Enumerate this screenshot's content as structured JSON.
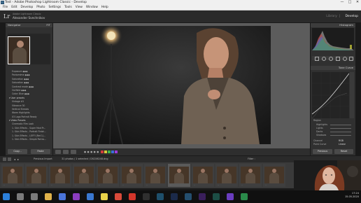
{
  "window": {
    "title": "Test - Adobe Photoshop Lightroom Classic - Develop",
    "controls": [
      "—",
      "□",
      "✕"
    ]
  },
  "menu": [
    "File",
    "Edit",
    "Develop",
    "Photo",
    "Settings",
    "Tools",
    "View",
    "Window",
    "Help"
  ],
  "identity": {
    "logo": "Lr",
    "line1": "Adobe Lightroom Classic",
    "line2": "Alexander Svechnikov",
    "modules": [
      "Library",
      "Develop"
    ],
    "active_module": "Develop"
  },
  "left_panel": {
    "navigator_label": "Navigator",
    "navigator_zoom": "FIT",
    "presets": [
      "Exposure ◆◆◆",
      "Pantomime ◆◆◆",
      "Saturation ◆◆◆",
      "Saturation ◆◆◆",
      "Contrast mode ◆◆◆",
      "Outfield ◆◆◆",
      "Color: Blue ◆◆◆"
    ],
    "group2_label": "▾ User presets",
    "group2": [
      "Vintage #1",
      "Vibrance 30",
      "Vertical Streaks",
      "Warm Highlights",
      "X3 Logo Portrait Ready"
    ],
    "group3_label": "▾ Video Presets",
    "group3": [
      "Cinematic Film Look",
      "1. Skin Effects - Super Mod Pr...",
      "1. Skin Effects - Portrait Finish...",
      "1. Skin Effects - LOFFI (Ret 1)...",
      "1. Skin Effects - Simple Portra..."
    ],
    "copy_label": "Copy...",
    "paste_label": "Paste"
  },
  "right_panel": {
    "histogram_label": "Histogram",
    "tone_curve_label": "Tone Curve",
    "region_label": "Region",
    "sliders": [
      "Highlights",
      "Lights",
      "Darks",
      "Shadows"
    ],
    "channel_label": "Channel",
    "channel_value": "RGB",
    "point_curve_label": "Point Curve",
    "point_curve_value": "Linear",
    "previous_label": "Previous",
    "reset_label": "Reset"
  },
  "filmstrip": {
    "source": "Previous Import",
    "info": "31 photos / 1 selected / DSC06248.dng",
    "filter_label": "Filter :"
  },
  "taskbar": {
    "icons": [
      {
        "name": "start-icon",
        "color": "#2b7fd9"
      },
      {
        "name": "search-icon",
        "color": "#7a7a7a"
      },
      {
        "name": "task-view-icon",
        "color": "#7a7a7a"
      },
      {
        "name": "explorer-icon",
        "color": "#e0b24a"
      },
      {
        "name": "store-icon",
        "color": "#4a74d9"
      },
      {
        "name": "onenote-icon",
        "color": "#8b3dbf"
      },
      {
        "name": "mail-icon",
        "color": "#3a78d0"
      },
      {
        "name": "yandex-icon",
        "color": "#e8d24a"
      },
      {
        "name": "browser-icon",
        "color": "#d94a3a"
      },
      {
        "name": "opera-icon",
        "color": "#d3362b"
      },
      {
        "name": "media-icon",
        "color": "#2f2f2f"
      },
      {
        "name": "lightroom-icon",
        "color": "#1e4f6b"
      },
      {
        "name": "photoshop-icon",
        "color": "#1b2a4a"
      },
      {
        "name": "lightroom-classic-icon",
        "color": "#244e6e"
      },
      {
        "name": "premiere-icon",
        "color": "#3a1f5c"
      },
      {
        "name": "audition-icon",
        "color": "#1c4d45"
      },
      {
        "name": "app-icon",
        "color": "#6a3dbf"
      },
      {
        "name": "vpn-icon",
        "color": "#2a8a4a"
      }
    ],
    "time": "17:24",
    "date": "15.05.2020"
  },
  "colors": {
    "accent_blue": "#2b7fd9"
  }
}
